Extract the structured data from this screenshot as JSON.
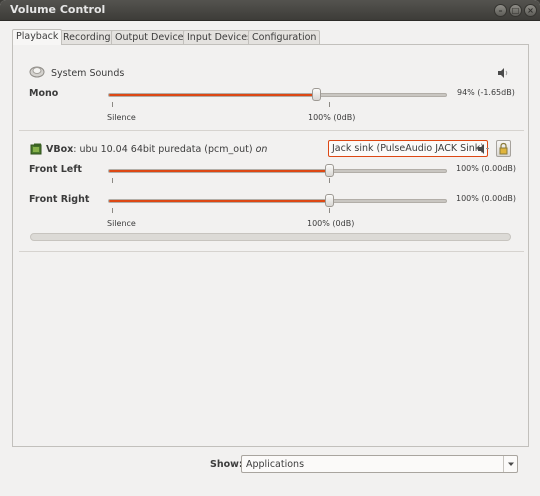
{
  "window": {
    "title": "Volume Control"
  },
  "tabs": [
    {
      "label": "Playback",
      "active": true
    },
    {
      "label": "Recording",
      "active": false
    },
    {
      "label": "Output Devices",
      "active": false
    },
    {
      "label": "Input Devices",
      "active": false
    },
    {
      "label": "Configuration",
      "active": false
    }
  ],
  "system_sounds": {
    "name": "System Sounds",
    "channel_label": "Mono",
    "volume_percent": 94,
    "volume_text": "94% (-1.65dB)",
    "mark_silence": "Silence",
    "mark_100": "100% (0dB)"
  },
  "vbox": {
    "app_name": "VBox",
    "description": ": ubu 10.04 64bit puredata (pcm_out)",
    "on_label": "on",
    "sink_label": "Jack sink (PulseAudio JACK Sink)",
    "front_left_label": "Front Left",
    "front_left_percent": 100,
    "front_left_text": "100% (0.00dB)",
    "front_right_label": "Front Right",
    "front_right_percent": 100,
    "front_right_text": "100% (0.00dB)",
    "mark_silence": "Silence",
    "mark_100": "100% (0dB)"
  },
  "footer": {
    "show_label": "Show:",
    "show_value": "Applications"
  },
  "icons": {
    "speaker": "speaker-icon",
    "lock": "lock-icon",
    "system_sounds": "system-sounds-icon",
    "vbox": "vbox-icon",
    "dropdown": "chevron-down-icon"
  },
  "colors": {
    "accent": "#dd4814",
    "titlebar": "#3c3b37",
    "window": "#f2f1f0"
  }
}
